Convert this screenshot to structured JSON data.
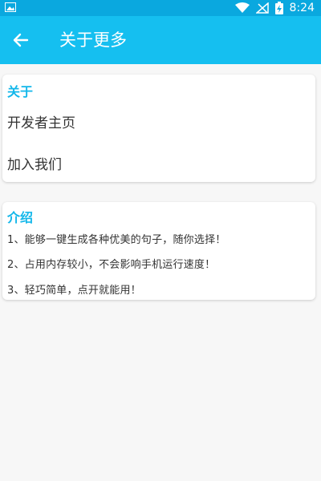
{
  "status_bar": {
    "time": "8:24"
  },
  "app_bar": {
    "title": "关于更多"
  },
  "about_section": {
    "header": "关于",
    "items": [
      {
        "label": "开发者主页"
      },
      {
        "label": "加入我们"
      }
    ]
  },
  "intro_section": {
    "header": "介绍",
    "lines": [
      "1、能够一键生成各种优美的句子，随你选择！",
      "2、占用内存较小，不会影响手机运行速度！",
      "3、轻巧简单，点开就能用！"
    ]
  },
  "colors": {
    "primary": "#15bff0",
    "status_bar": "#0aa8df",
    "accent_text": "#13b7ea"
  }
}
